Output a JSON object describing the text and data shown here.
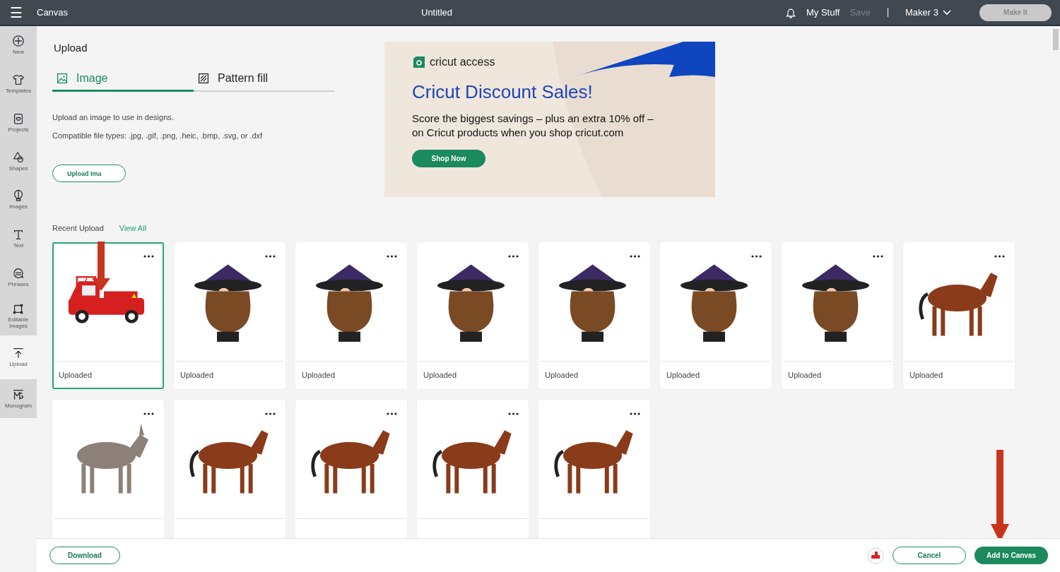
{
  "header": {
    "menu": "☰",
    "app": "Canvas",
    "title": "Untitled",
    "my_stuff": "My Stuff",
    "save": "Save",
    "machine": "Maker 3",
    "make_it": "Make It"
  },
  "sidebar": [
    {
      "kind": "new",
      "label": "New",
      "selected": false
    },
    {
      "kind": "templates",
      "label": "Templates",
      "selected": false
    },
    {
      "kind": "projects",
      "label": "Projects",
      "selected": false
    },
    {
      "kind": "shapes",
      "label": "Shapes",
      "selected": false
    },
    {
      "kind": "images",
      "label": "Images",
      "selected": false
    },
    {
      "kind": "text",
      "label": "Text",
      "selected": false
    },
    {
      "kind": "phrases",
      "label": "Phrases",
      "selected": false
    },
    {
      "kind": "editable",
      "label": "Editable Images",
      "selected": false
    },
    {
      "kind": "upload",
      "label": "Upload",
      "selected": true
    },
    {
      "kind": "monogram",
      "label": "Monogram",
      "selected": false
    }
  ],
  "upload": {
    "title": "Upload",
    "tabs": [
      {
        "kind": "image",
        "label": "Image",
        "selected": true
      },
      {
        "kind": "pattern",
        "label": "Pattern fill",
        "selected": false
      }
    ],
    "intro": "Upload an image to use in designs.",
    "file_types": "Compatible file types: .jpg, .gif, .png, .heic, .bmp, .svg, or .dxf",
    "upload_button": "Upload Ima",
    "recent": "Recent Upload",
    "view_all": "View All"
  },
  "banner": {
    "brand": "cricut access",
    "headline": "Cricut Discount Sales!",
    "body": "Score the biggest savings – plus an extra 10% off –\non Cricut products when you shop cricut.com",
    "button": "Shop Now"
  },
  "uploads": [
    {
      "kind": "truck",
      "caption": "Uploaded",
      "selected": true
    },
    {
      "kind": "gnome",
      "caption": "Uploaded",
      "selected": false
    },
    {
      "kind": "gnome",
      "caption": "Uploaded",
      "selected": false
    },
    {
      "kind": "gnome",
      "caption": "Uploaded",
      "selected": false
    },
    {
      "kind": "gnome",
      "caption": "Uploaded",
      "selected": false
    },
    {
      "kind": "gnome",
      "caption": "Uploaded",
      "selected": false
    },
    {
      "kind": "gnome",
      "caption": "Uploaded",
      "selected": false
    },
    {
      "kind": "horse",
      "caption": "Uploaded",
      "selected": false
    },
    {
      "kind": "donkey",
      "selected": false
    },
    {
      "kind": "horse",
      "selected": false
    },
    {
      "kind": "horse",
      "selected": false
    },
    {
      "kind": "horse",
      "selected": false
    },
    {
      "kind": "horse",
      "selected": false
    }
  ],
  "footer": {
    "download": "Download",
    "cancel": "Cancel",
    "add": "Add to Canvas"
  }
}
